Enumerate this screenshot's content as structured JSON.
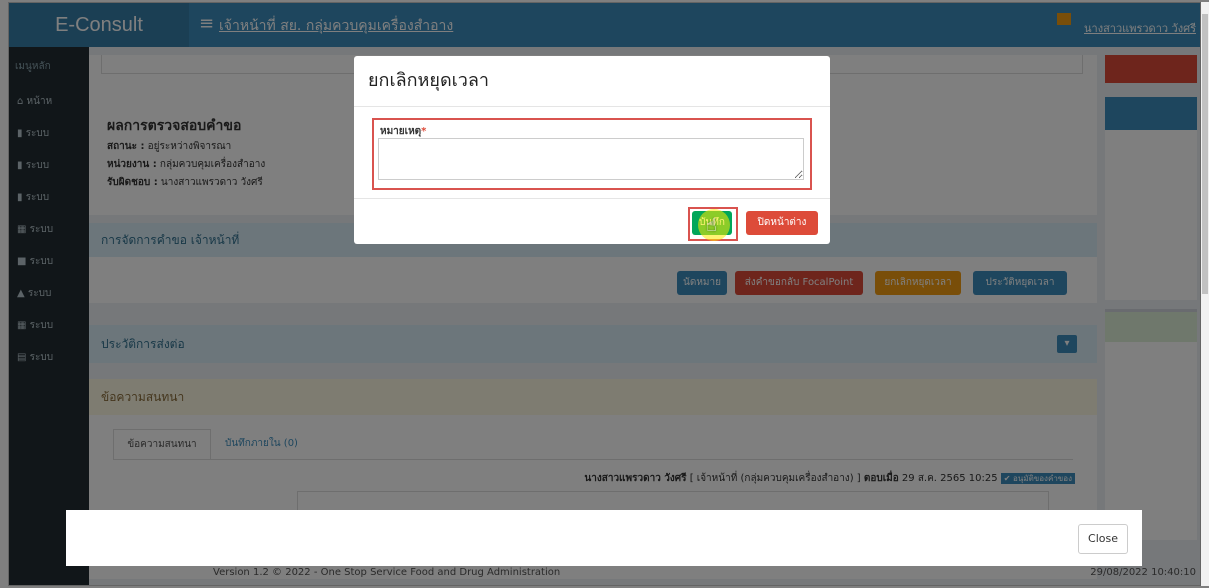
{
  "app": {
    "brand": "E-Consult",
    "header_title": "เจ้าหน้าที่ สย. กลุ่มควบคุมเครื่องสำอาง",
    "user": "นางสาวแพรวดาว วังศรี"
  },
  "sidebar": {
    "header": "เมนูหลัก",
    "items": [
      "หน้าห",
      "ระบบ",
      "ระบบ",
      "ระบบ",
      "ระบบ",
      "ระบบ",
      "ระบบ",
      "ระบบ",
      "ระบบ"
    ]
  },
  "result": {
    "title": "ผลการตรวจสอบคำขอ",
    "status_label": "สถานะ :",
    "status": "อยู่ระหว่างพิจารณา",
    "agency_label": "หน่วยงาน :",
    "agency": "กลุ่มควบคุมเครื่องสำอาง",
    "owner_label": "รับผิดชอบ :",
    "owner": "นางสาวแพรวดาว วังศรี"
  },
  "manage": {
    "title": "การจัดการคำขอ เจ้าหน้าที่",
    "buttons": [
      "นัดหมาย",
      "ส่งคำขอกลับ FocalPoint",
      "ยกเลิกหยุดเวลา",
      "ประวัติหยุดเวลา"
    ]
  },
  "history": {
    "title": "ประวัติการส่งต่อ"
  },
  "chat": {
    "title": "ข้อความสนทนา",
    "tabs": [
      "ข้อความสนทนา",
      "บันทึกภายใน (0)"
    ],
    "author": "นางสาวแพรวดาว วังศรี",
    "role": "[ เจ้าหน้าที่ (กลุ่มควบคุมเครื่องสำอาง) ]",
    "replied_label": "ตอบเมื่อ",
    "replied_at": "29 ส.ค. 2565 10:25",
    "badge": "✔ อนุมัติของคำของ"
  },
  "footer": {
    "version": "Version 1.2 © 2022 - One Stop Service Food and Drug Administration",
    "datetime": "29/08/2022 10:40:10"
  },
  "modal": {
    "title": "ยกเลิกหยุดเวลา",
    "field_label": "หมายเหตุ",
    "required": "*",
    "remark_value": "",
    "save": "บันทึก",
    "close": "ปิดหน้าต่าง"
  },
  "bottom_modal": {
    "close": "Close"
  },
  "colors": {
    "primary": "#3c8dbc",
    "success": "#00a65a",
    "danger": "#dd4b39",
    "warning": "#f39c12",
    "sidebar": "#222d32"
  }
}
